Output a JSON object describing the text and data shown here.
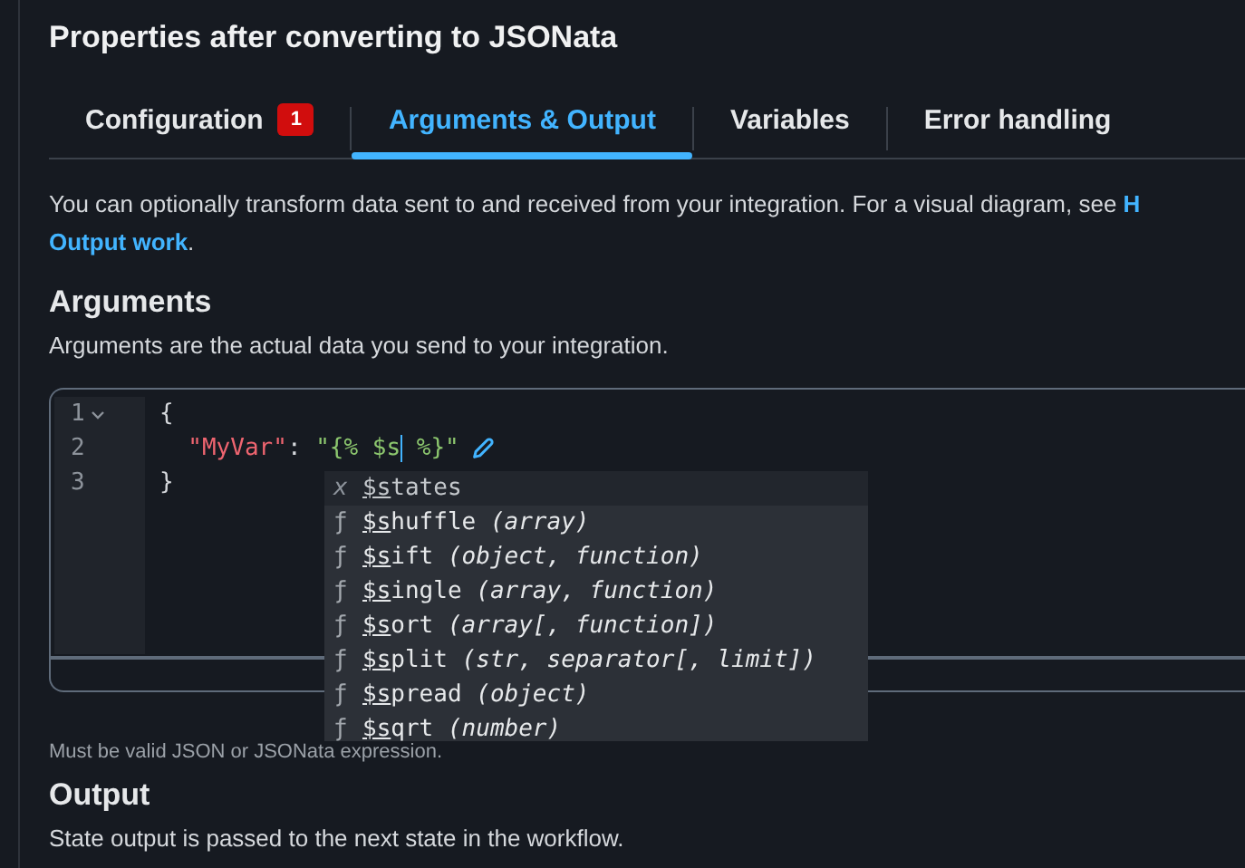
{
  "title": "Properties after converting to JSONata",
  "tabs": [
    {
      "label": "Configuration",
      "badge": "1",
      "selected": false
    },
    {
      "label": "Arguments & Output",
      "selected": true
    },
    {
      "label": "Variables",
      "selected": false
    },
    {
      "label": "Error handling",
      "selected": false
    }
  ],
  "description": {
    "text": "You can optionally transform data sent to and received from your integration. For a visual diagram, see ",
    "link_start": "H",
    "link_end": "Output work",
    "end": "."
  },
  "arguments": {
    "heading": "Arguments",
    "subtitle": "Arguments are the actual data you send to your integration.",
    "editor": {
      "lines": [
        {
          "number": "1",
          "foldable": true,
          "tokens": [
            {
              "kind": "punct",
              "text": "{"
            }
          ]
        },
        {
          "number": "2",
          "foldable": false,
          "tokens": [
            {
              "kind": "key",
              "text": "\"MyVar\""
            },
            {
              "kind": "punct",
              "text": ": "
            },
            {
              "kind": "string",
              "text": "\"{% $s"
            },
            {
              "kind": "cursor"
            },
            {
              "kind": "string",
              "text": " %}\""
            },
            {
              "kind": "edit"
            }
          ]
        },
        {
          "number": "3",
          "foldable": false,
          "tokens": [
            {
              "kind": "punct",
              "text": "}"
            }
          ]
        }
      ],
      "suggestions": [
        {
          "kind": "variable",
          "icon": "x",
          "match": "$s",
          "rest": "tates",
          "selected": true
        },
        {
          "kind": "function",
          "icon": "ƒ",
          "match": "$s",
          "rest": "huffle",
          "params": "(array)",
          "selected": false
        },
        {
          "kind": "function",
          "icon": "ƒ",
          "match": "$s",
          "rest": "ift",
          "params": "(object, function)",
          "selected": false
        },
        {
          "kind": "function",
          "icon": "ƒ",
          "match": "$s",
          "rest": "ingle",
          "params": "(array, function)",
          "selected": false
        },
        {
          "kind": "function",
          "icon": "ƒ",
          "match": "$s",
          "rest": "ort",
          "params": "(array[, function])",
          "selected": false
        },
        {
          "kind": "function",
          "icon": "ƒ",
          "match": "$s",
          "rest": "plit",
          "params": "(str, separator[, limit])",
          "selected": false
        },
        {
          "kind": "function",
          "icon": "ƒ",
          "match": "$s",
          "rest": "pread",
          "params": "(object)",
          "selected": false
        },
        {
          "kind": "function",
          "icon": "ƒ",
          "match": "$s",
          "rest": "qrt",
          "params": "(number)",
          "selected": false
        }
      ]
    },
    "hint": "Must be valid JSON or JSONata expression."
  },
  "output": {
    "heading": "Output",
    "subtitle": "State output is passed to the next state in the workflow."
  }
}
